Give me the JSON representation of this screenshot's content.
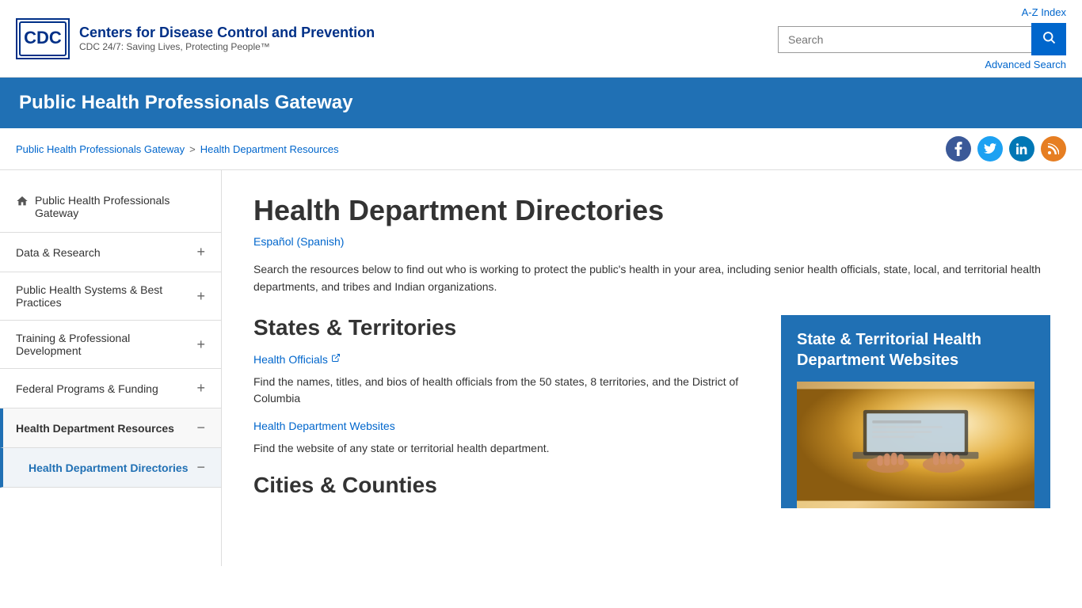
{
  "header": {
    "az_index": "A-Z Index",
    "search_placeholder": "Search",
    "search_button_icon": "🔍",
    "advanced_search": "Advanced Search",
    "logo_text": "CDC",
    "org_name": "Centers for Disease Control and Prevention",
    "org_subtitle": "CDC 24/7: Saving Lives, Protecting People™"
  },
  "banner": {
    "title": "Public Health Professionals Gateway"
  },
  "breadcrumb": {
    "home": "Public Health Professionals Gateway",
    "current": "Health Department Resources"
  },
  "social": {
    "facebook": "f",
    "twitter": "t",
    "linkedin": "in",
    "rss": "rss"
  },
  "sidebar": {
    "home_label": "Public Health Professionals Gateway",
    "items": [
      {
        "label": "Data & Research",
        "icon": "plus"
      },
      {
        "label": "Public Health Systems & Best Practices",
        "icon": "plus"
      },
      {
        "label": "Training & Professional Development",
        "icon": "plus"
      },
      {
        "label": "Federal Programs & Funding",
        "icon": "plus"
      },
      {
        "label": "Health Department Resources",
        "icon": "minus",
        "active": true
      },
      {
        "label": "Health Department Directories",
        "icon": "minus",
        "sub": true
      }
    ]
  },
  "content": {
    "title": "Health Department Directories",
    "spanish_link": "Español (Spanish)",
    "intro": "Search the resources below to find out who is working to protect the public's health in your area, including senior health officials, state, local, and territorial health departments, and tribes and Indian organizations.",
    "states_title": "States & Territories",
    "health_officials_link": "Health Officials",
    "health_officials_desc": "Find the names, titles, and bios of health officials from the 50 states, 8 territories, and the District of Columbia",
    "health_dept_websites_link": "Health Department Websites",
    "health_dept_websites_desc": "Find the website of any state or territorial health department.",
    "cities_title": "Cities & Counties"
  },
  "sidebar_panel": {
    "title": "State & Territorial Health Department Websites"
  }
}
